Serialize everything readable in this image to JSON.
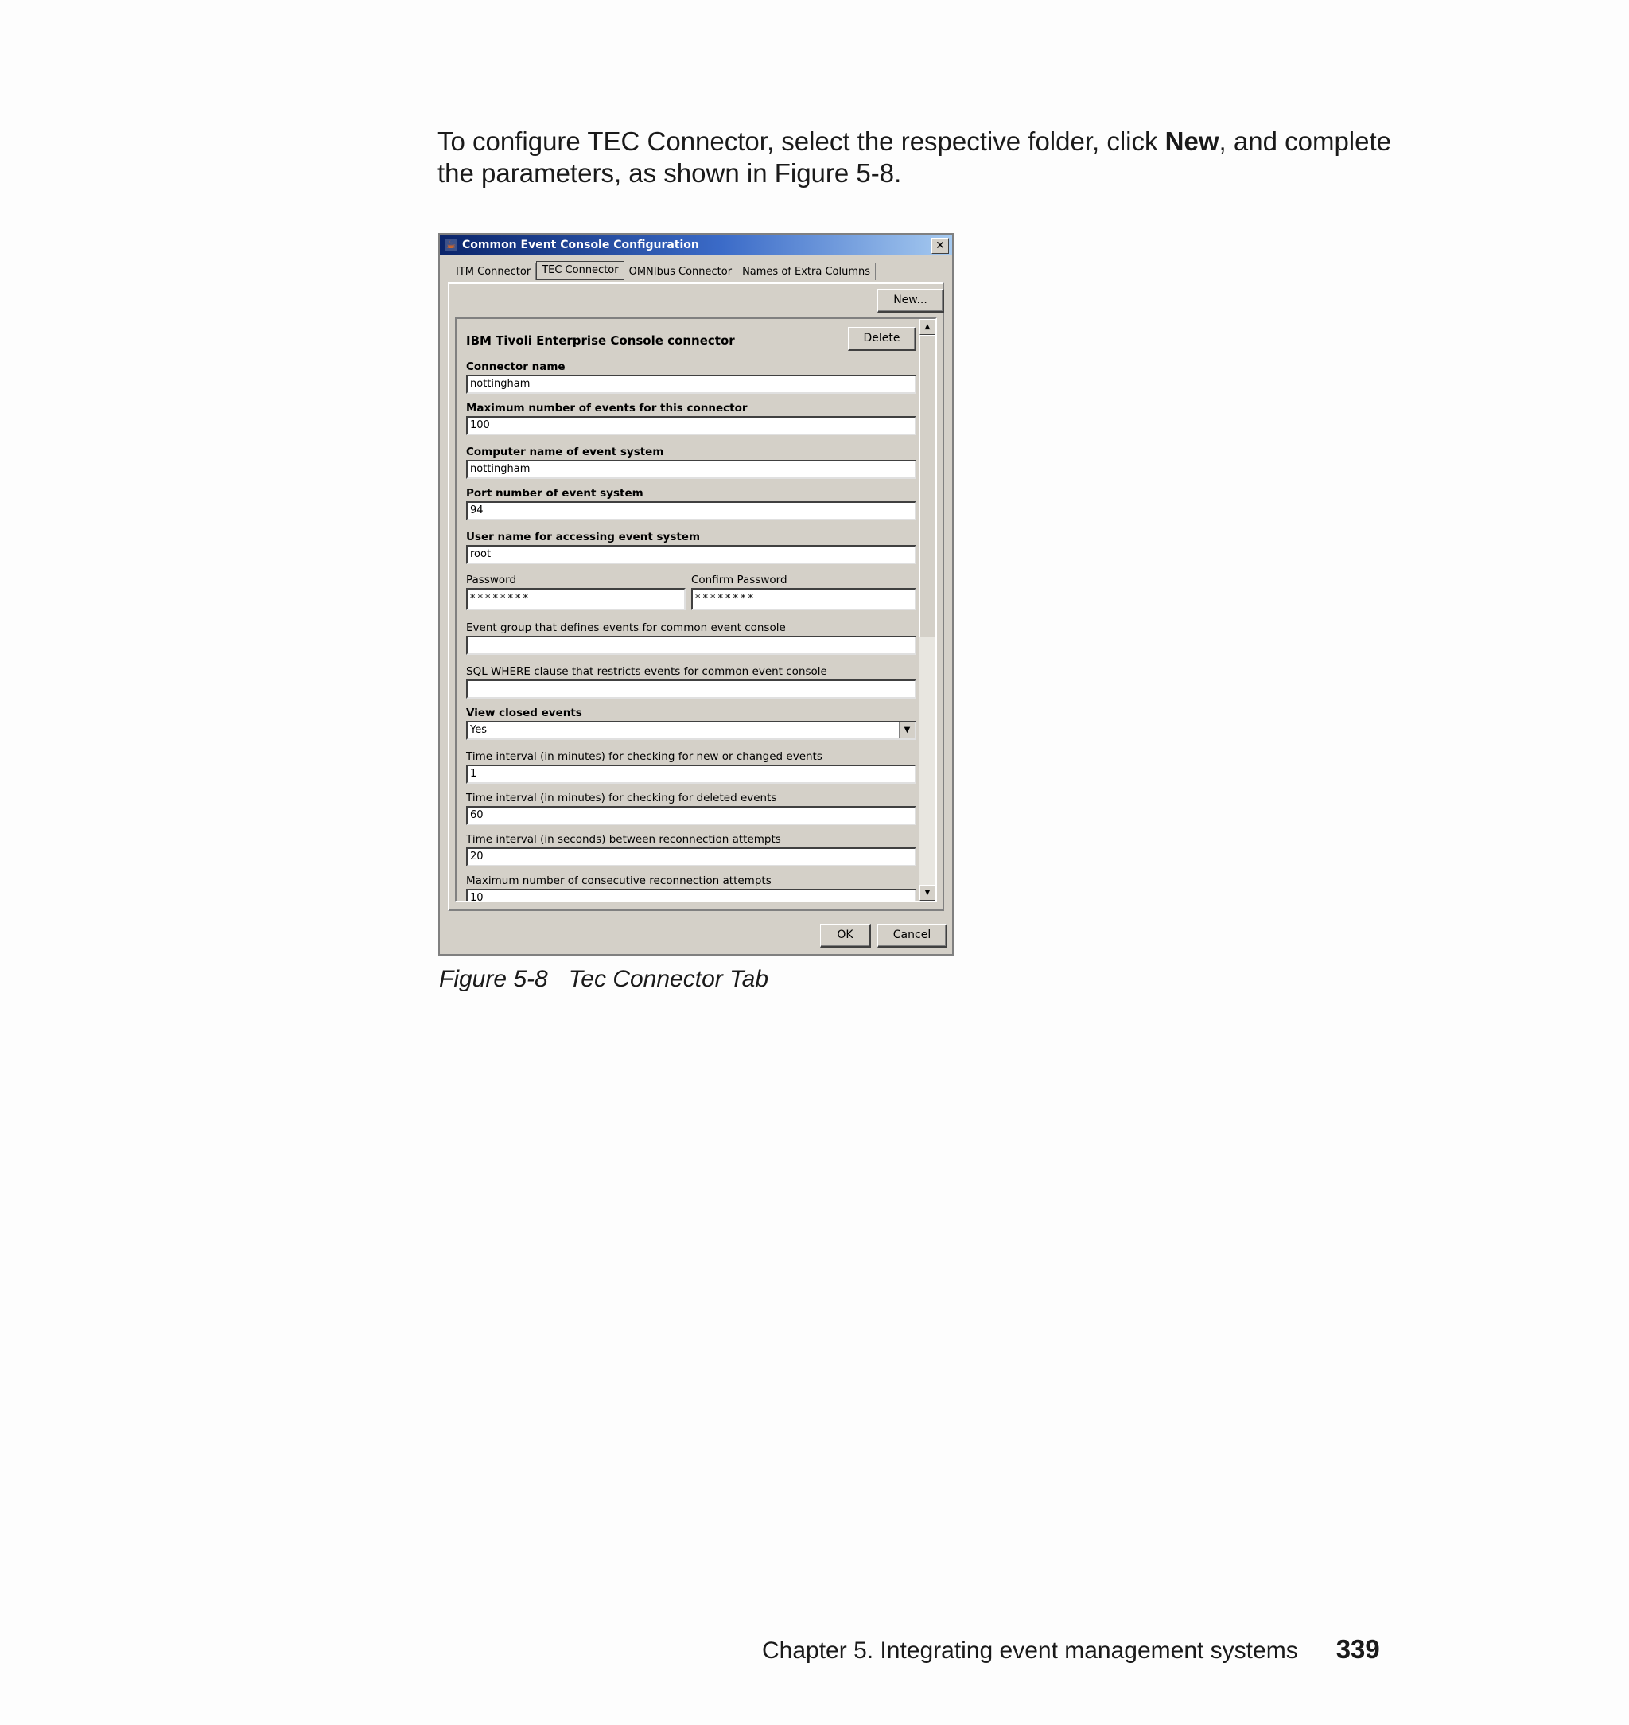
{
  "intro": {
    "before": "To configure TEC Connector, select the respective folder, click ",
    "bold": "New",
    "after": ", and complete the parameters, as shown in Figure 5-8."
  },
  "dialog": {
    "title": "Common Event Console Configuration",
    "close_glyph": "✕",
    "tabs": [
      "ITM Connector",
      "TEC Connector",
      "OMNIbus Connector",
      "Names of Extra Columns"
    ],
    "new_label": "New...",
    "section_title": "IBM Tivoli Enterprise Console connector",
    "delete_label": "Delete",
    "fields": {
      "connector_name": {
        "label": "Connector name",
        "value": "nottingham"
      },
      "max_events": {
        "label": "Maximum number of events for this connector",
        "value": "100"
      },
      "computer_name": {
        "label": "Computer name of event system",
        "value": "nottingham"
      },
      "port": {
        "label": "Port number of event system",
        "value": "94"
      },
      "user_name": {
        "label": "User name for accessing event system",
        "value": "root"
      },
      "password": {
        "label": "Password",
        "value": "********"
      },
      "confirm_password": {
        "label": "Confirm Password",
        "value": "********"
      },
      "event_group": {
        "label": "Event group that defines events for common event console",
        "value": ""
      },
      "sql_where": {
        "label": "SQL WHERE clause that restricts events for common event console",
        "value": ""
      },
      "view_closed": {
        "label": "View closed events",
        "value": "Yes"
      },
      "interval_new": {
        "label": "Time interval (in minutes) for checking for new or changed events",
        "value": "1"
      },
      "interval_deleted": {
        "label": "Time interval (in minutes) for checking for deleted events",
        "value": "60"
      },
      "interval_reconnect": {
        "label": "Time interval (in seconds) between reconnection attempts",
        "value": "20"
      },
      "max_reconnect": {
        "label": "Maximum number of consecutive reconnection attempts",
        "value": "10"
      }
    },
    "ok_label": "OK",
    "cancel_label": "Cancel"
  },
  "caption": {
    "number": "Figure 5-8",
    "title": "Tec Connector Tab"
  },
  "footer": {
    "chapter": "Chapter 5. Integrating event management systems",
    "page": "339"
  }
}
